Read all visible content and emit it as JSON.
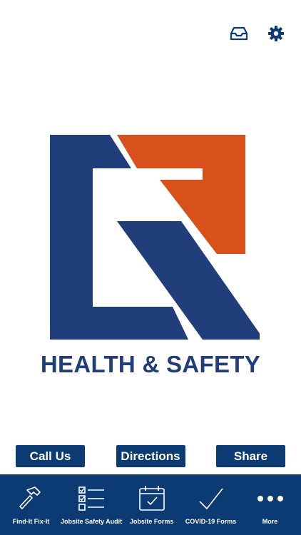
{
  "header": {
    "icons": [
      "inbox-icon",
      "gear-icon"
    ]
  },
  "logo": {
    "text": "HEALTH & SAFETY",
    "colors": {
      "navy": "#1f3e7a",
      "orange": "#d8501a"
    }
  },
  "actions": {
    "call_label": "Call Us",
    "directions_label": "Directions",
    "share_label": "Share"
  },
  "tabbar": {
    "items": [
      {
        "label": "Find-It  Fix-It",
        "icon": "hammer-icon"
      },
      {
        "label": "Jobsite Safety Audit",
        "icon": "checklist-icon"
      },
      {
        "label": "Jobsite Forms",
        "icon": "calendar-check-icon"
      },
      {
        "label": "COVID-19 Forms",
        "icon": "checkmark-icon"
      },
      {
        "label": "More",
        "icon": "more-icon"
      }
    ]
  },
  "theme": {
    "primary": "#0c3a73",
    "background": "#ffffff"
  }
}
